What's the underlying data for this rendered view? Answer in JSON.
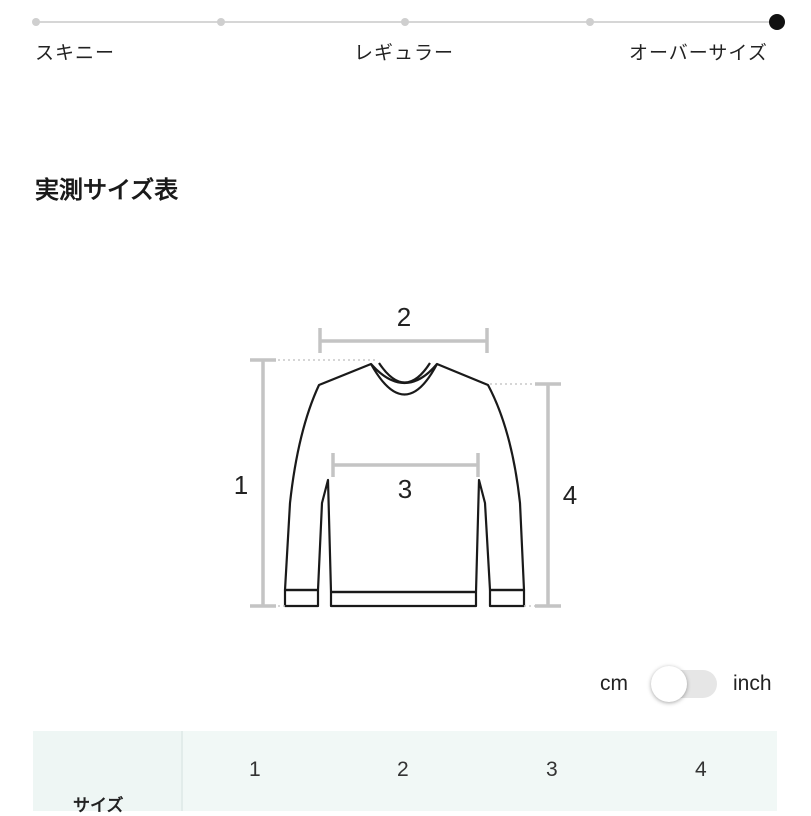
{
  "fit_scale": {
    "labels": [
      "スキニー",
      "レギュラー",
      "オーバーサイズ"
    ],
    "positions": 5,
    "selected_index": 4
  },
  "section_title": "実測サイズ表",
  "diagram": {
    "measure_labels": [
      "1",
      "2",
      "3",
      "4"
    ]
  },
  "unit_toggle": {
    "left_label": "cm",
    "right_label": "inch",
    "selected": "cm"
  },
  "size_table": {
    "row_label": "サイズ",
    "columns": [
      "1",
      "2",
      "3",
      "4"
    ]
  }
}
